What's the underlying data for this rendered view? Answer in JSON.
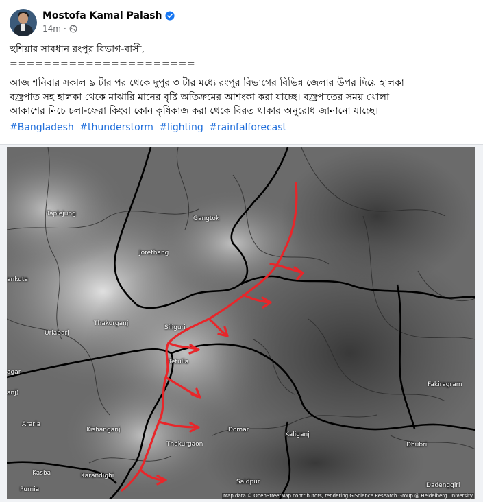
{
  "post": {
    "author": "Mostofa Kamal Palash",
    "verified_icon": "verified-badge-icon",
    "time": "14m",
    "separator": "·",
    "audience_icon": "globe-icon",
    "title_line": "হুশিয়ার সাবধান রংপুর বিভাগ-বাসী,",
    "divider_line": "======================",
    "body_line1": "আজ শনিবার সকাল ৯ টার পর থেকে দুপুর ৩ টার মধ্যে রংপুর বিভাগের বিভিন্ন জেলার উপর দিয়ে হালকা",
    "body_line2": "বজ্রপাত সহ হালকা থেকে মাঝারি মানের বৃষ্টি অতিক্রমের আশংকা করা যাচ্ছে।  বজ্রপাতের সময় খোলা",
    "body_line3": "আকাশের নিচে চলা-ফেরা কিংবা কোন কৃষিকাজ করা থেকে বিরত থাকার অনুরোধ জানানো যাচ্ছে।",
    "hashtags": [
      "#Bangladesh",
      "#thunderstorm",
      "#lighting",
      "#rainfalforecast"
    ]
  },
  "map": {
    "places": [
      {
        "name": "Taplejung"
      },
      {
        "name": "Gangtok"
      },
      {
        "name": "Jorethang"
      },
      {
        "name": "ankuta"
      },
      {
        "name": "Siliguri"
      },
      {
        "name": "Urlabari"
      },
      {
        "name": "Thakurganj"
      },
      {
        "name": "agar"
      },
      {
        "name": "anj)"
      },
      {
        "name": "Tetulia"
      },
      {
        "name": "Araria"
      },
      {
        "name": "Kishanganj"
      },
      {
        "name": "Domar"
      },
      {
        "name": "Thakurgaon"
      },
      {
        "name": "Kasba"
      },
      {
        "name": "Karandighi"
      },
      {
        "name": "Purnia"
      },
      {
        "name": "Saidpur"
      },
      {
        "name": "Kaliganj"
      },
      {
        "name": "Dhubri"
      },
      {
        "name": "Fakiragram"
      },
      {
        "name": "Dadenggiri"
      }
    ],
    "attribution": "Map data © OpenStreetMap contributors, rendering GIScience Research Group @ Heidelberg University",
    "arrow_color": "#e8262a",
    "border_color": "#000000"
  }
}
